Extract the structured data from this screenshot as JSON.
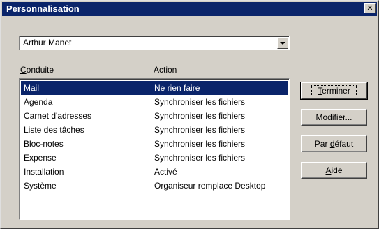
{
  "window": {
    "title": "Personnalisation",
    "close_glyph": "✕"
  },
  "user_select": {
    "value": "Arthur Manet"
  },
  "columns": {
    "conduit": {
      "mnemonic": "C",
      "rest": "onduite"
    },
    "action": "Action"
  },
  "rows": [
    {
      "conduit": "Mail",
      "action": "Ne rien faire",
      "selected": true
    },
    {
      "conduit": "Agenda",
      "action": "Synchroniser les fichiers"
    },
    {
      "conduit": "Carnet d'adresses",
      "action": "Synchroniser les fichiers"
    },
    {
      "conduit": "Liste des tâches",
      "action": "Synchroniser les fichiers"
    },
    {
      "conduit": "Bloc-notes",
      "action": "Synchroniser les fichiers"
    },
    {
      "conduit": "Expense",
      "action": "Synchroniser les fichiers"
    },
    {
      "conduit": "Installation",
      "action": "Activé"
    },
    {
      "conduit": "Système",
      "action": "Organiseur remplace Desktop"
    }
  ],
  "buttons": {
    "done": {
      "mnemonic": "T",
      "rest": "erminer"
    },
    "change": {
      "mnemonic": "M",
      "rest": "odifier..."
    },
    "default": {
      "pre": "Par ",
      "mnemonic": "d",
      "rest": "éfaut"
    },
    "help": {
      "mnemonic": "A",
      "rest": "ide"
    }
  },
  "colors": {
    "title_bar": "#0a246a",
    "selection": "#0a246a",
    "face": "#d4d0c8"
  }
}
